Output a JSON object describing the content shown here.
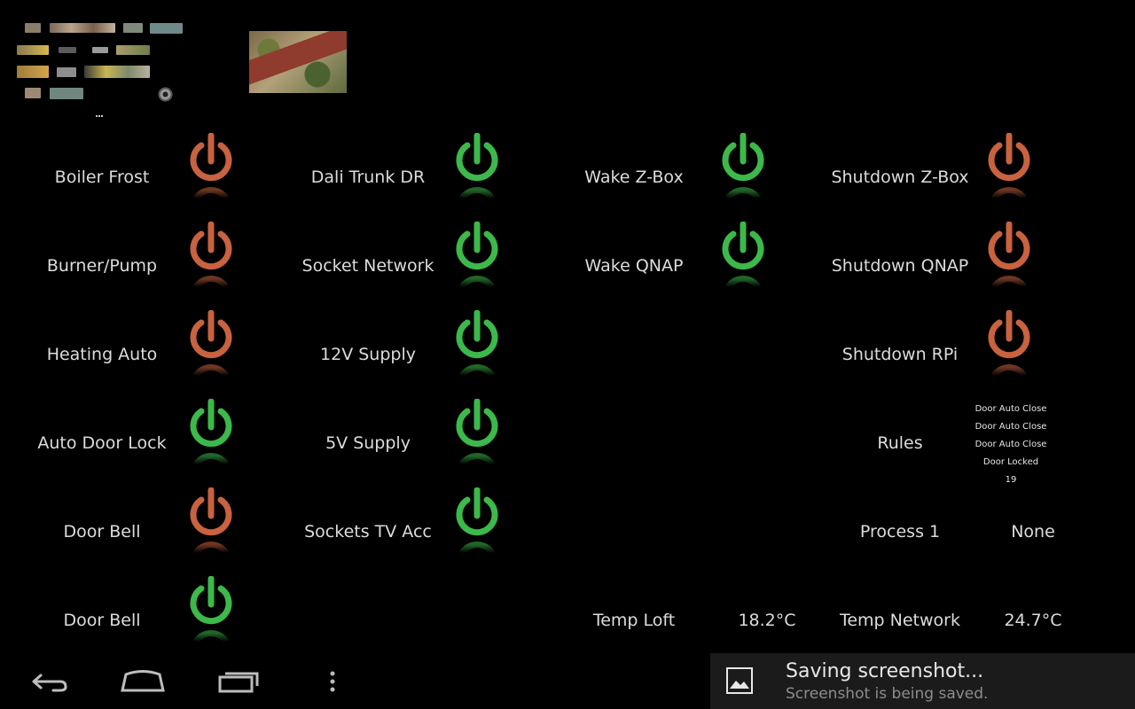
{
  "colors": {
    "on": "#3cb94a",
    "off": "#c8623f",
    "background": "#000000"
  },
  "switches": [
    {
      "label": "Boiler Frost",
      "state": "off"
    },
    {
      "label": "Burner/Pump",
      "state": "off"
    },
    {
      "label": "Heating Auto",
      "state": "off"
    },
    {
      "label": "Auto Door Lock",
      "state": "on"
    },
    {
      "label": "Door Bell",
      "state": "off"
    },
    {
      "label": "Door Bell",
      "state": "on"
    },
    {
      "label": "Dali Trunk DR",
      "state": "on"
    },
    {
      "label": "Socket Network",
      "state": "on"
    },
    {
      "label": "12V Supply",
      "state": "on"
    },
    {
      "label": "5V Supply",
      "state": "on"
    },
    {
      "label": "Sockets TV Acc",
      "state": "on"
    },
    {
      "label": "Wake Z-Box",
      "state": "on"
    },
    {
      "label": "Wake QNAP",
      "state": "on"
    },
    {
      "label": "Shutdown Z-Box",
      "state": "off"
    },
    {
      "label": "Shutdown QNAP",
      "state": "off"
    },
    {
      "label": "Shutdown RPi",
      "state": "off"
    }
  ],
  "rules": {
    "label": "Rules",
    "items": [
      "Door Auto Close",
      "Door Auto Close",
      "Door Auto Close",
      "Door Locked",
      "19"
    ]
  },
  "process": {
    "label": "Process 1",
    "value": "None"
  },
  "temps": [
    {
      "label": "Temp Loft",
      "value": "18.2°C"
    },
    {
      "label": "Temp Network",
      "value": "24.7°C"
    }
  ],
  "navbar": {
    "icons": [
      "back-icon",
      "home-icon",
      "recent-apps-icon",
      "menu-overflow-icon"
    ]
  },
  "toast": {
    "title": "Saving screenshot...",
    "subtitle": "Screenshot is being saved.",
    "icon": "image-icon"
  }
}
